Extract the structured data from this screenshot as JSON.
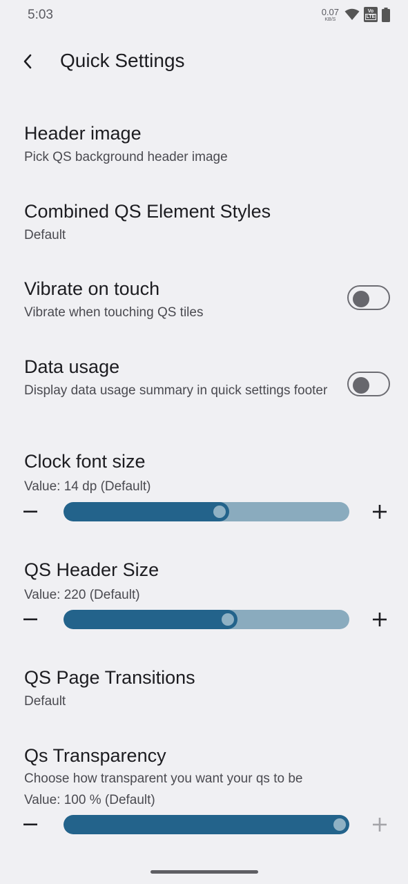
{
  "status_bar": {
    "time": "5:03",
    "net_speed": "0.07",
    "net_unit": "KB/S",
    "volte_top": "Vo",
    "volte_bottom": "LTE",
    "icons": [
      "wifi-icon",
      "volte-icon",
      "battery-icon"
    ]
  },
  "app_bar": {
    "title": "Quick Settings",
    "back_icon": "back-arrow-icon"
  },
  "items": [
    {
      "title": "Header image",
      "subtitle": "Pick QS background header image"
    },
    {
      "title": "Combined QS Element Styles",
      "subtitle": "Default"
    },
    {
      "title": "Vibrate on touch",
      "subtitle": "Vibrate when touching QS tiles",
      "toggle": "off"
    },
    {
      "title": "Data usage",
      "subtitle": "Display data usage summary in quick settings footer",
      "toggle": "off"
    },
    {
      "title": "Clock font size",
      "value_text": "Value: 14 dp (Default)",
      "slider_fraction": 0.55
    },
    {
      "title": "QS Header Size",
      "value_text": "Value: 220 (Default)",
      "slider_fraction": 0.58
    },
    {
      "title": "QS Page Transitions",
      "subtitle": "Default"
    },
    {
      "title": "Qs Transparency",
      "subtitle": "Choose how transparent you want your qs to be",
      "value_text": "Value: 100 % (Default)",
      "slider_fraction": 1.0
    }
  ],
  "colors": {
    "background": "#f0f0f3",
    "slider_fill": "#23638b",
    "slider_track": "#8aabbe",
    "text_primary": "#1c1c20",
    "text_secondary": "#4a4a50"
  }
}
